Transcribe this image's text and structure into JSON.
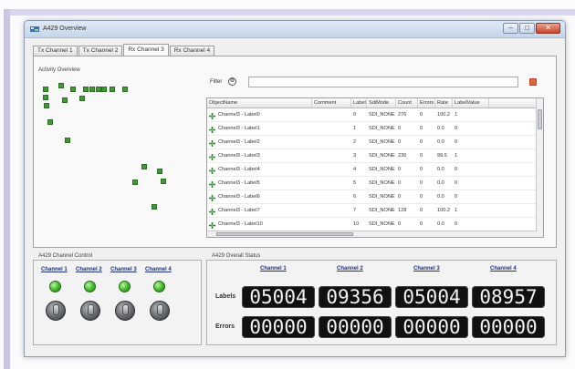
{
  "window": {
    "title": "A429 Overview",
    "controls": {
      "minimize": "–",
      "maximize": "□",
      "close": "✕"
    }
  },
  "tabs": [
    {
      "label": "Tx Channel 1",
      "active": false
    },
    {
      "label": "Tx Channel 2",
      "active": false
    },
    {
      "label": "Rx Channel 3",
      "active": true
    },
    {
      "label": "Rx Channel 4",
      "active": false
    }
  ],
  "activity": {
    "title": "Activity Overview"
  },
  "filter": {
    "label": "Filter",
    "value": "",
    "icon": "gear-icon"
  },
  "table": {
    "columns": [
      "ObjectName",
      "Comment",
      "Label",
      "SdiMode",
      "Count",
      "Errors",
      "Rate",
      "LabelValue"
    ],
    "rows": [
      {
        "name": "Channel3 - Label0",
        "comment": "",
        "label": "0",
        "sdi": "SDI_NONE",
        "count": "276",
        "errors": "0",
        "rate": "100.2",
        "value": "1"
      },
      {
        "name": "Channel3 - Label1",
        "comment": "",
        "label": "1",
        "sdi": "SDI_NONE",
        "count": "0",
        "errors": "0",
        "rate": "0.0",
        "value": "0"
      },
      {
        "name": "Channel3 - Label2",
        "comment": "",
        "label": "2",
        "sdi": "SDI_NONE",
        "count": "0",
        "errors": "0",
        "rate": "0.0",
        "value": "0"
      },
      {
        "name": "Channel3 - Label3",
        "comment": "",
        "label": "3",
        "sdi": "SDI_NONE",
        "count": "236",
        "errors": "0",
        "rate": "99.5",
        "value": "1"
      },
      {
        "name": "Channel3 - Label4",
        "comment": "",
        "label": "4",
        "sdi": "SDI_NONE",
        "count": "0",
        "errors": "0",
        "rate": "0.0",
        "value": "0"
      },
      {
        "name": "Channel3 - Label5",
        "comment": "",
        "label": "5",
        "sdi": "SDI_NONE",
        "count": "0",
        "errors": "0",
        "rate": "0.0",
        "value": "0"
      },
      {
        "name": "Channel3 - Label6",
        "comment": "",
        "label": "6",
        "sdi": "SDI_NONE",
        "count": "0",
        "errors": "0",
        "rate": "0.0",
        "value": "0"
      },
      {
        "name": "Channel3 - Label7",
        "comment": "",
        "label": "7",
        "sdi": "SDI_NONE",
        "count": "128",
        "errors": "0",
        "rate": "100.2",
        "value": "1"
      },
      {
        "name": "Channel3 - Label10",
        "comment": "",
        "label": "10",
        "sdi": "SDI_NONE",
        "count": "0",
        "errors": "0",
        "rate": "0.0",
        "value": "0"
      }
    ]
  },
  "control": {
    "title": "A429 Channel Control",
    "channels": [
      "Channel 1",
      "Channel 2",
      "Channel 3",
      "Channel 4"
    ]
  },
  "status": {
    "title": "A429 Overall Status",
    "channels": [
      "Channel 1",
      "Channel 2",
      "Channel 3",
      "Channel 4"
    ],
    "labels_row": "Labels",
    "errors_row": "Errors",
    "labels": [
      "05004",
      "09356",
      "05004",
      "08957"
    ],
    "errors": [
      "00000",
      "00000",
      "00000",
      "00000"
    ]
  },
  "colors": {
    "led_on": "#3fb52a",
    "activity_square": "#3f9a33",
    "counter_bg": "#111111",
    "channel_link": "#1f2f7a"
  }
}
